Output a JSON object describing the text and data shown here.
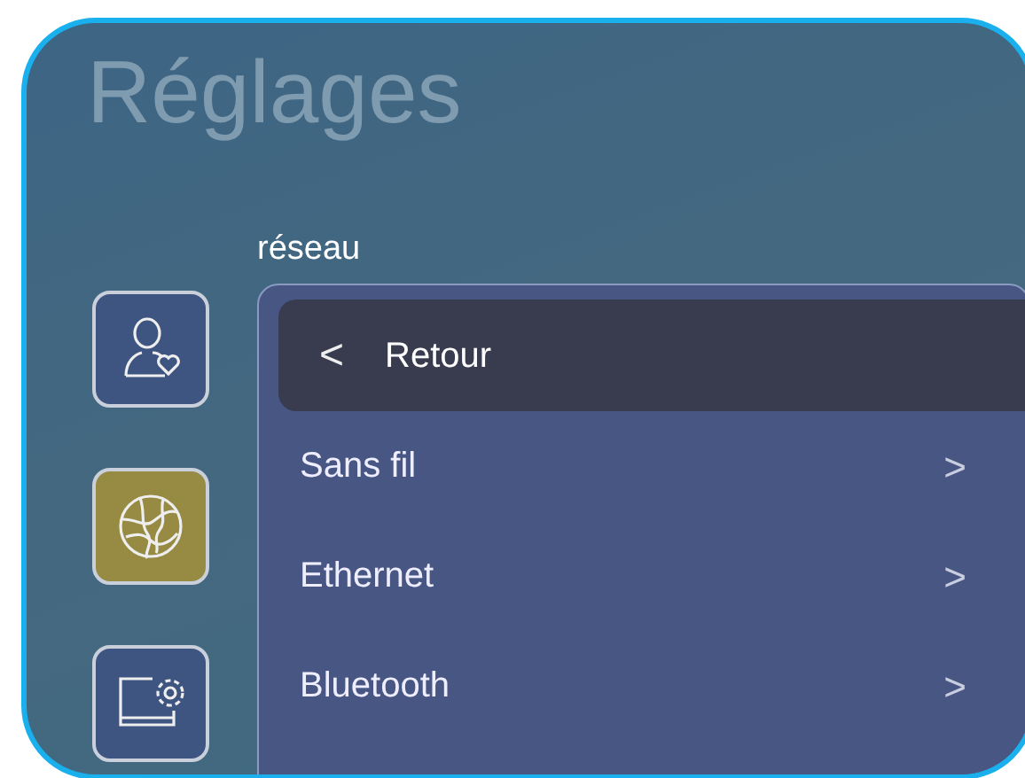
{
  "title": "Réglages",
  "section": "réseau",
  "sidebar": {
    "items": [
      {
        "kind": "user",
        "selected": false
      },
      {
        "kind": "network",
        "selected": true
      },
      {
        "kind": "display",
        "selected": false
      }
    ]
  },
  "panel": {
    "back": {
      "icon": "<",
      "label": "Retour"
    },
    "items": [
      {
        "label": "Sans fil",
        "chevron": ">"
      },
      {
        "label": "Ethernet",
        "chevron": ">"
      },
      {
        "label": "Bluetooth",
        "chevron": ">"
      }
    ]
  }
}
